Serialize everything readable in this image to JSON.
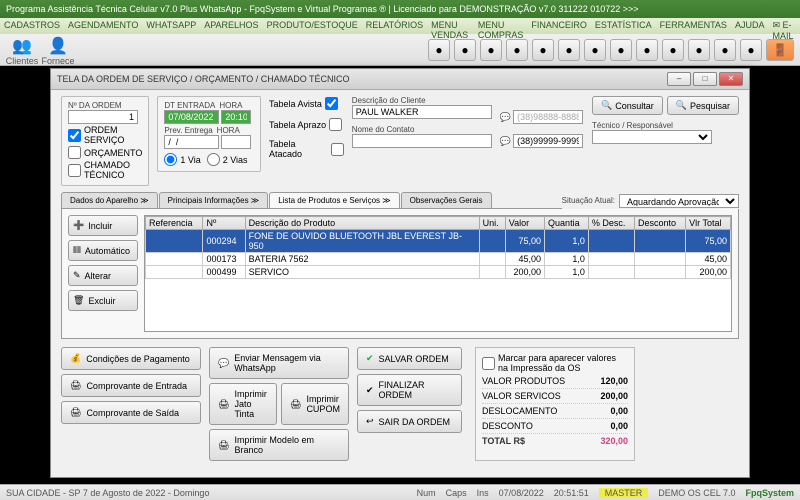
{
  "app": {
    "title": "Programa Assistência Técnica Celular v7.0 Plus WhatsApp - FpqSystem e Virtual Programas ® | Licenciado para  DEMONSTRAÇÃO v7.0 311222 010722 >>>"
  },
  "menu": [
    "CADASTROS",
    "AGENDAMENTO",
    "WHATSAPP",
    "APARELHOS",
    "PRODUTO/ESTOQUE",
    "RELATÓRIOS",
    "MENU VENDAS",
    "MENU COMPRAS",
    "FINANCEIRO",
    "ESTATÍSTICA",
    "FERRAMENTAS",
    "AJUDA",
    "E-MAIL"
  ],
  "bigicons": [
    {
      "ic": "👥",
      "t": "Clientes"
    },
    {
      "ic": "👤",
      "t": "Fornece"
    }
  ],
  "dialog": {
    "title": "TELA DA ORDEM DE SERVIÇO / ORÇAMENTO / CHAMADO TÉCNICO",
    "order_no_label": "Nº DA ORDEM",
    "order_no": "1",
    "chk_ordem": "ORDEM SERVIÇO",
    "chk_orc": "ORÇAMENTO",
    "chk_chamado": "CHAMADO TÉCNICO",
    "dt_label": "DT ENTRADA",
    "dt": "07/08/2022",
    "hora_label": "HORA",
    "hora": "20:10",
    "prev_label": "Prev. Entrega",
    "prev": "/  /",
    "hora2": "",
    "via1": "1 Via",
    "via2": "2 Vias",
    "tabela_avista": "Tabela Avista",
    "tabela_aprazo": "Tabela Aprazo",
    "tabela_atacado": "Tabela Atacado",
    "desc_cliente_lbl": "Descrição do Cliente",
    "cliente": "PAUL WALKER",
    "contato_lbl": "Nome do Contato",
    "contato": "",
    "tel1": "(38)98888-8888",
    "tel2": "(38)99999-9999",
    "tecnico_lbl": "Técnico / Responsável",
    "consultar": "Consultar",
    "pesquisar": "Pesquisar",
    "tabs": [
      "Dados do Aparelho ≫",
      "Principais Informações ≫",
      "Lista de Produtos e Serviços ≫",
      "Observações Gerais"
    ],
    "sit_lbl": "Situação Atual:",
    "sit_val": "Aguardando Aprovação",
    "side": {
      "incluir": "Incluir",
      "auto": "Automático",
      "alterar": "Alterar",
      "excluir": "Excluir"
    },
    "gridcols": [
      "Referencia",
      "Nº",
      "Descrição do Produto",
      "Uni.",
      "Valor",
      "Quantia",
      "% Desc.",
      "Desconto",
      "Vlr Total"
    ],
    "gridrows": [
      {
        "ref": "",
        "n": "000294",
        "desc": "FONE DE OUVIDO BLUETOOTH JBL EVEREST JB-950",
        "uni": "",
        "val": "75,00",
        "q": "1,0",
        "pd": "",
        "d": "",
        "tot": "75,00",
        "sel": true
      },
      {
        "ref": "",
        "n": "000173",
        "desc": "BATERIA 7562",
        "uni": "",
        "val": "45,00",
        "q": "1,0",
        "pd": "",
        "d": "",
        "tot": "45,00"
      },
      {
        "ref": "",
        "n": "000499",
        "desc": "SERVICO",
        "uni": "",
        "val": "200,00",
        "q": "1,0",
        "pd": "",
        "d": "",
        "tot": "200,00"
      }
    ],
    "actions": {
      "cond": "Condições de Pagamento",
      "wa": "Enviar Mensagem via WhatsApp",
      "salvar": "SALVAR ORDEM",
      "compent": "Comprovante de Entrada",
      "jato": "Imprimir Jato Tinta",
      "cupom": "Imprimir CUPOM",
      "finalizar": "FINALIZAR ORDEM",
      "compsai": "Comprovante de Saída",
      "branco": "Imprimir Modelo em Branco",
      "sair": "SAIR DA ORDEM"
    },
    "marcar": "Marcar para aparecer valores na Impressão da OS",
    "totals": {
      "prod_lbl": "VALOR PRODUTOS",
      "prod": "120,00",
      "serv_lbl": "VALOR SERVICOS",
      "serv": "200,00",
      "desl_lbl": "DESLOCAMENTO",
      "desl": "0,00",
      "desc_lbl": "DESCONTO",
      "desc": "0,00",
      "tot_lbl": "TOTAL R$",
      "tot": "320,00"
    }
  },
  "status": {
    "loc": "SUA CIDADE - SP  7 de Agosto de 2022 - Domingo",
    "num": "Num",
    "caps": "Caps",
    "ins": "Ins",
    "date": "07/08/2022",
    "time": "20:51:51",
    "master": "MASTER",
    "demo": "DEMO OS CEL 7.0",
    "brand": "FpqSystem"
  }
}
